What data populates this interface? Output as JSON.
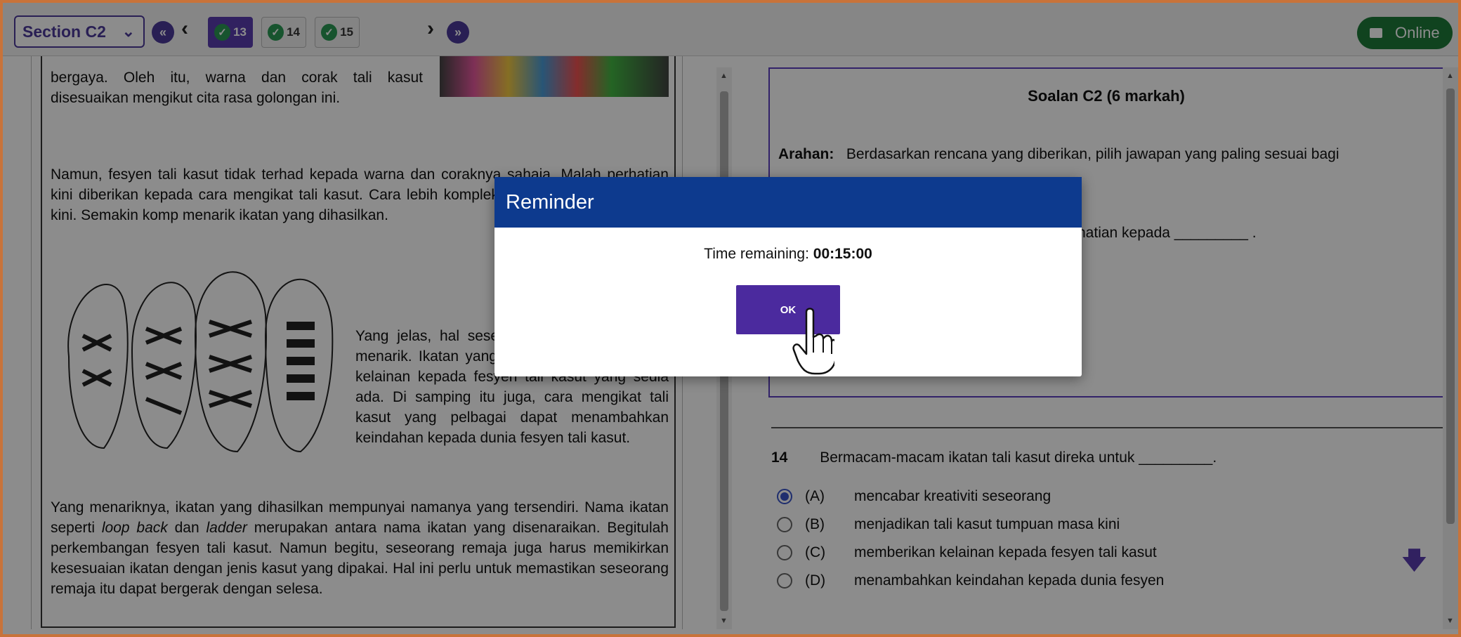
{
  "topbar": {
    "section_label": "Section C2",
    "first_icon": "double-chevron-left-icon",
    "prev_icon": "chevron-left-icon",
    "questions": [
      {
        "num": "13",
        "answered": true,
        "active": true
      },
      {
        "num": "14",
        "answered": true,
        "active": false
      },
      {
        "num": "15",
        "answered": true,
        "active": false
      }
    ],
    "next_icon": "chevron-right-icon",
    "last_icon": "double-chevron-right-icon",
    "status_label": "Online"
  },
  "passage": {
    "p1_a": "bergaya.   Oleh itu, warna dan corak tali kasut disesuaikan mengikut cita rasa golongan ini.",
    "p2": "Namun, fesyen tali kasut tidak terhad kepada warna dan coraknya sahaja.   Malah perhatian kini diberikan kepada cara mengikat tali kasut.  Cara lebih kompleks menjadi tumpuan masa kini.  Semakin komp menarik ikatan yang dihasilkan.",
    "p3": "Yang jelas, hal seseorang untuk ikatan yang menarik.  Ikatan yang pelbagai ini memberikan kelainan kepada fesyen tali kasut yang sedia ada.  Di samping itu juga, cara mengikat tali kasut yang pelbagai dapat menambahkan keindahan kepada dunia fesyen tali kasut.",
    "p4_before_1": "Yang menariknya, ikatan yang dihasilkan mempunyai namanya yang tersendiri.  Nama ikatan seperti ",
    "p4_em_1": "loop back",
    "p4_between": " dan ",
    "p4_em_2": "ladder",
    "p4_after": " merupakan antara nama ikatan yang disenaraikan.  Begitulah perkembangan fesyen tali kasut.  Namun begitu, seseorang remaja juga harus memikirkan kesesuaian ikatan dengan jenis kasut yang dipakai.  Hal ini perlu untuk memastikan seseorang remaja itu dapat bergerak dengan selesa."
  },
  "question_box": {
    "title": "Soalan C2 (6 markah)",
    "arahan_label": "Arahan:",
    "arahan_text": "Berdasarkan rencana yang diberikan, pilih jawapan yang paling sesuai bagi",
    "partial_line": "hatian kepada _________ ."
  },
  "question14": {
    "num": "14",
    "text": "Bermacam-macam ikatan tali kasut direka untuk _________.",
    "options": [
      {
        "key": "(A)",
        "text": "mencabar kreativiti seseorang",
        "selected": true
      },
      {
        "key": "(B)",
        "text": "menjadikan tali kasut tumpuan masa kini",
        "selected": false
      },
      {
        "key": "(C)",
        "text": "memberikan kelainan kepada fesyen tali kasut",
        "selected": false
      },
      {
        "key": "(D)",
        "text": "menambahkan keindahan kepada dunia fesyen",
        "selected": false
      }
    ]
  },
  "modal": {
    "title": "Reminder",
    "time_label": "Time remaining: ",
    "time_value": "00:15:00",
    "ok_label": "OK"
  },
  "colors": {
    "accent": "#4b3a9a",
    "modal_header": "#0d3a8e",
    "online": "#1e7a3a",
    "check": "#2a9a55"
  }
}
